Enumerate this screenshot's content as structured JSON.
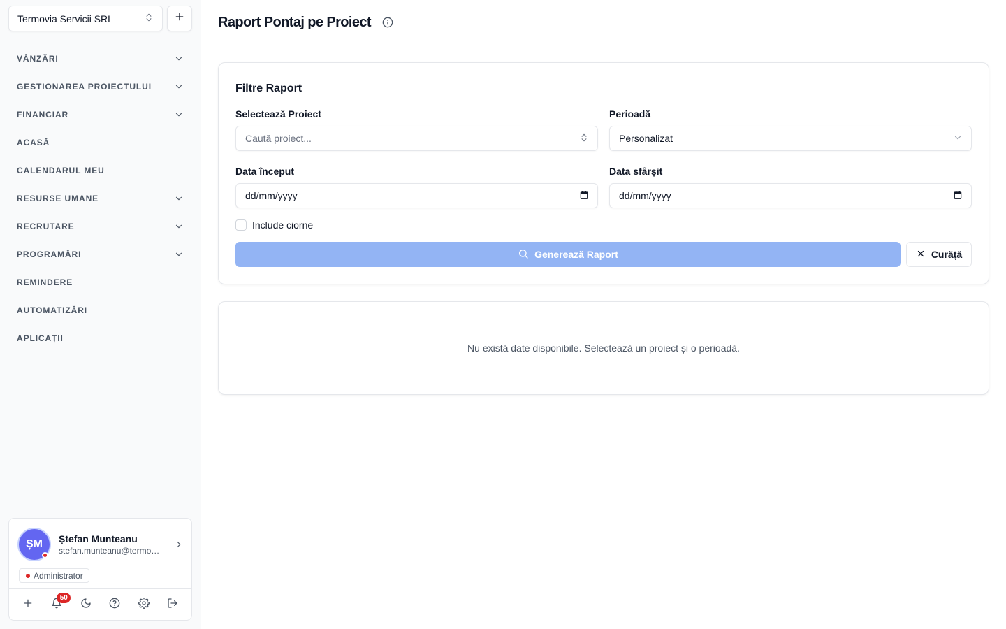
{
  "sidebar": {
    "company": {
      "name": "Termovia Servicii SRL"
    },
    "nav": [
      {
        "label": "VÂNZĂRI",
        "expandable": true
      },
      {
        "label": "GESTIONAREA PROIECTULUI",
        "expandable": true
      },
      {
        "label": "FINANCIAR",
        "expandable": true
      },
      {
        "label": "ACASĂ",
        "expandable": false
      },
      {
        "label": "CALENDARUL MEU",
        "expandable": false
      },
      {
        "label": "RESURSE UMANE",
        "expandable": true
      },
      {
        "label": "RECRUTARE",
        "expandable": true
      },
      {
        "label": "PROGRAMĂRI",
        "expandable": true
      },
      {
        "label": "REMINDERE",
        "expandable": false
      },
      {
        "label": "AUTOMATIZĂRI",
        "expandable": false
      },
      {
        "label": "APLICAȚII",
        "expandable": false
      }
    ],
    "user": {
      "initials": "ȘM",
      "name": "Ștefan Munteanu",
      "email": "stefan.munteanu@termovia.ro",
      "role": "Administrator",
      "notifications_count": "50"
    }
  },
  "header": {
    "title": "Raport Pontaj pe Proiect"
  },
  "filters": {
    "title": "Filtre Raport",
    "project": {
      "label": "Selectează Proiect",
      "placeholder": "Caută proiect..."
    },
    "period": {
      "label": "Perioadă",
      "value": "Personalizat"
    },
    "start_date": {
      "label": "Data început",
      "value": "dd/mm/yyyy"
    },
    "end_date": {
      "label": "Data sfârșit",
      "value": "dd/mm/yyyy"
    },
    "include_drafts": {
      "label": "Include ciorne",
      "checked": false
    },
    "generate_label": "Generează Raport",
    "clear_label": "Curăță"
  },
  "results": {
    "empty_message": "Nu există date disponibile. Selectează un proiect și o perioadă."
  },
  "colors": {
    "primary_disabled": "#93b4f4",
    "avatar": "#6366f1",
    "alert": "#dc2626"
  }
}
